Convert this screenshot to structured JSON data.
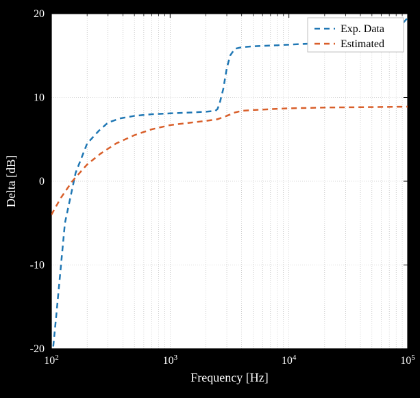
{
  "chart_data": {
    "type": "line",
    "xlabel": "Frequency [Hz]",
    "ylabel": "Delta [dB]",
    "xscale": "log",
    "xlim": [
      100,
      100000
    ],
    "ylim": [
      -20,
      20
    ],
    "x_tick_labels": [
      "10^2",
      "10^3",
      "10^4",
      "10^5"
    ],
    "y_ticks": [
      -20,
      -10,
      0,
      10,
      20
    ],
    "series": [
      {
        "name": "Exp. Data",
        "color": "#1f77b4",
        "dash": "8,6",
        "x": [
          100,
          110,
          130,
          160,
          200,
          250,
          300,
          380,
          500,
          700,
          1000,
          1500,
          2000,
          2400,
          2500,
          2600,
          2800,
          3000,
          3200,
          3500,
          4000,
          5000,
          7000,
          10000,
          20000,
          50000,
          80000,
          100000
        ],
        "y": [
          -22,
          -16,
          -5,
          1,
          4.5,
          6,
          7,
          7.5,
          7.8,
          8,
          8.1,
          8.2,
          8.3,
          8.4,
          8.6,
          9.2,
          11,
          13.5,
          15,
          15.8,
          16,
          16.1,
          16.2,
          16.3,
          16.5,
          17,
          18,
          19.5
        ]
      },
      {
        "name": "Estimated",
        "color": "#d95f2a",
        "dash": "8,6",
        "x": [
          100,
          120,
          150,
          200,
          260,
          350,
          500,
          700,
          1000,
          1500,
          2000,
          2500,
          3000,
          3500,
          4000,
          5000,
          7000,
          10000,
          20000,
          50000,
          100000
        ],
        "y": [
          -4,
          -2,
          0,
          2,
          3.3,
          4.5,
          5.5,
          6.2,
          6.7,
          7,
          7.2,
          7.4,
          7.8,
          8.2,
          8.4,
          8.5,
          8.6,
          8.7,
          8.8,
          8.85,
          8.9
        ]
      }
    ],
    "legend_position": "upper right"
  },
  "legend": {
    "entries": [
      {
        "label": "Exp. Data",
        "color": "#1f77b4"
      },
      {
        "label": "Estimated",
        "color": "#d95f2a"
      }
    ]
  }
}
